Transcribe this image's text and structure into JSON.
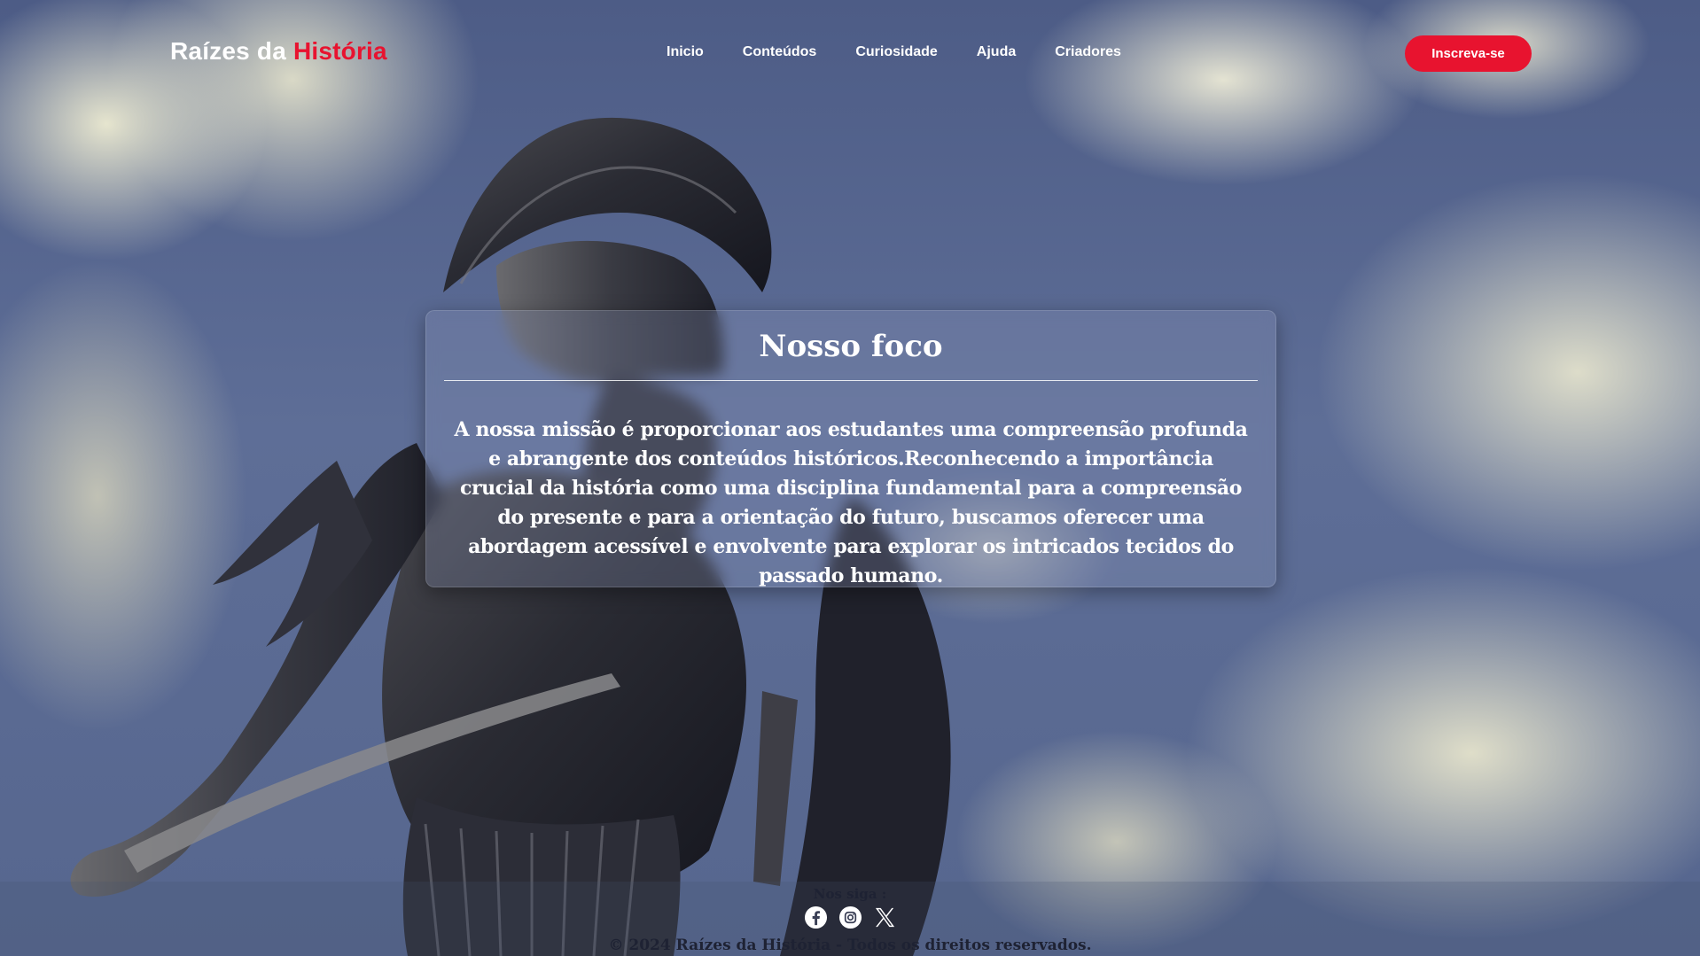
{
  "header": {
    "brand_main": "Raízes da ",
    "brand_accent": "História",
    "nav": [
      "Inicio",
      "Conteúdos",
      "Curiosidade",
      "Ajuda",
      "Criadores"
    ],
    "cta_label": "Inscreva-se"
  },
  "focus": {
    "title": "Nosso foco",
    "body": "A nossa missão é proporcionar aos estudantes uma compreensão profunda e abrangente dos conteúdos históricos.Reconhecendo a importância crucial da história como uma disciplina fundamental para a compreensão do presente e para a orientação do futuro, buscamos oferecer uma abordagem acessível e envolvente para explorar os intricados tecidos do passado humano."
  },
  "footer": {
    "follow_label": "Nos siga :",
    "socials": [
      "facebook-icon",
      "instagram-icon",
      "x-icon"
    ],
    "copyright": "© 2024 Raízes da História - Todos os direitos reservados."
  },
  "colors": {
    "accent": "#e8132f",
    "text_light": "#ffffff",
    "footer_text": "#1e2233"
  }
}
